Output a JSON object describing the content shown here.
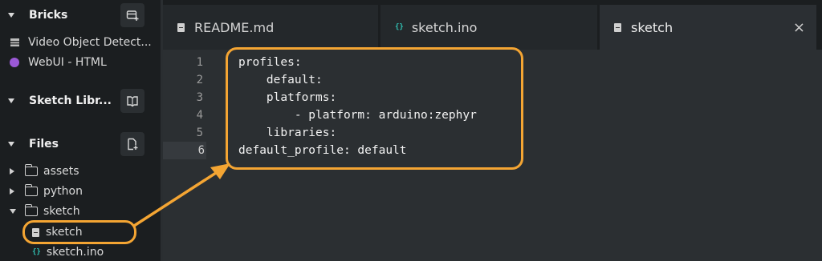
{
  "sidebar": {
    "bricks": {
      "title": "Bricks",
      "items": [
        {
          "label": "Video Object Detect..."
        },
        {
          "label": "WebUI - HTML"
        }
      ]
    },
    "sketch_libraries": {
      "title": "Sketch Libr..."
    },
    "files": {
      "title": "Files",
      "tree": [
        {
          "label": "assets"
        },
        {
          "label": "python"
        },
        {
          "label": "sketch"
        },
        {
          "label": "sketch"
        },
        {
          "label": "sketch.ino"
        }
      ]
    }
  },
  "tabs": [
    {
      "label": "README.md",
      "icon": "file-icon"
    },
    {
      "label": "sketch.ino",
      "icon": "code-icon"
    },
    {
      "label": "sketch",
      "icon": "file-icon",
      "active": true,
      "close": "×"
    }
  ],
  "editor": {
    "line_numbers": [
      "1",
      "2",
      "3",
      "4",
      "5",
      "6"
    ],
    "current_line": "6",
    "lines": [
      "profiles:",
      "    default:",
      "    platforms:",
      "        - platform: arduino:zephyr",
      "    libraries:",
      "default_profile: default"
    ]
  },
  "colors": {
    "accent_orange": "#f4a533",
    "code_icon_teal": "#31c2b5",
    "webui_purple": "#9b59d6"
  }
}
